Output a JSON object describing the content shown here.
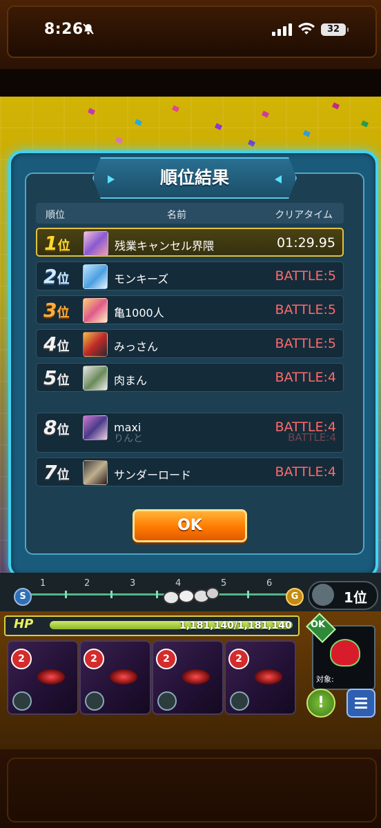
{
  "status_bar": {
    "time": "8:26",
    "battery": "32"
  },
  "dialog": {
    "title": "順位結果",
    "headers": {
      "rank": "順位",
      "name": "名前",
      "time": "クリアタイム"
    },
    "rows": [
      {
        "rank_num": "1",
        "rank_suffix": "位",
        "name": "残業キャンセル界隈",
        "time": "01:29.95"
      },
      {
        "rank_num": "2",
        "rank_suffix": "位",
        "name": "モンキーズ",
        "time": "BATTLE:5"
      },
      {
        "rank_num": "3",
        "rank_suffix": "位",
        "name": "亀1000人",
        "time": "BATTLE:5"
      },
      {
        "rank_num": "4",
        "rank_suffix": "位",
        "name": "みっさん",
        "time": "BATTLE:5"
      },
      {
        "rank_num": "5",
        "rank_suffix": "位",
        "name": "肉まん",
        "time": "BATTLE:4"
      },
      {
        "rank_num": "8",
        "rank_suffix": "位",
        "name": "maxi",
        "ghost_name": "りんと",
        "time": "BATTLE:4",
        "ghost_time": "BATTLE:4"
      },
      {
        "rank_num": "7",
        "rank_suffix": "位",
        "name": "サンダーロード",
        "time": "BATTLE:4"
      }
    ],
    "ok_label": "OK"
  },
  "track": {
    "stages": [
      "1",
      "2",
      "3",
      "4",
      "5",
      "6"
    ],
    "start_label": "S",
    "goal_label": "G",
    "current_rank": "1位"
  },
  "hud": {
    "hp_label": "HP",
    "hp_value": "1,181,140/1,181,140",
    "card_counts": [
      "2",
      "2",
      "2",
      "2"
    ],
    "item_ok": "OK",
    "target_label": "対象:",
    "warn_label": "!"
  },
  "colors": {
    "dialog_border": "#3fd4f4",
    "first_row_border": "#e6c23a",
    "battle_text": "#ff6a6a",
    "ok_button": "#ff7a00"
  }
}
